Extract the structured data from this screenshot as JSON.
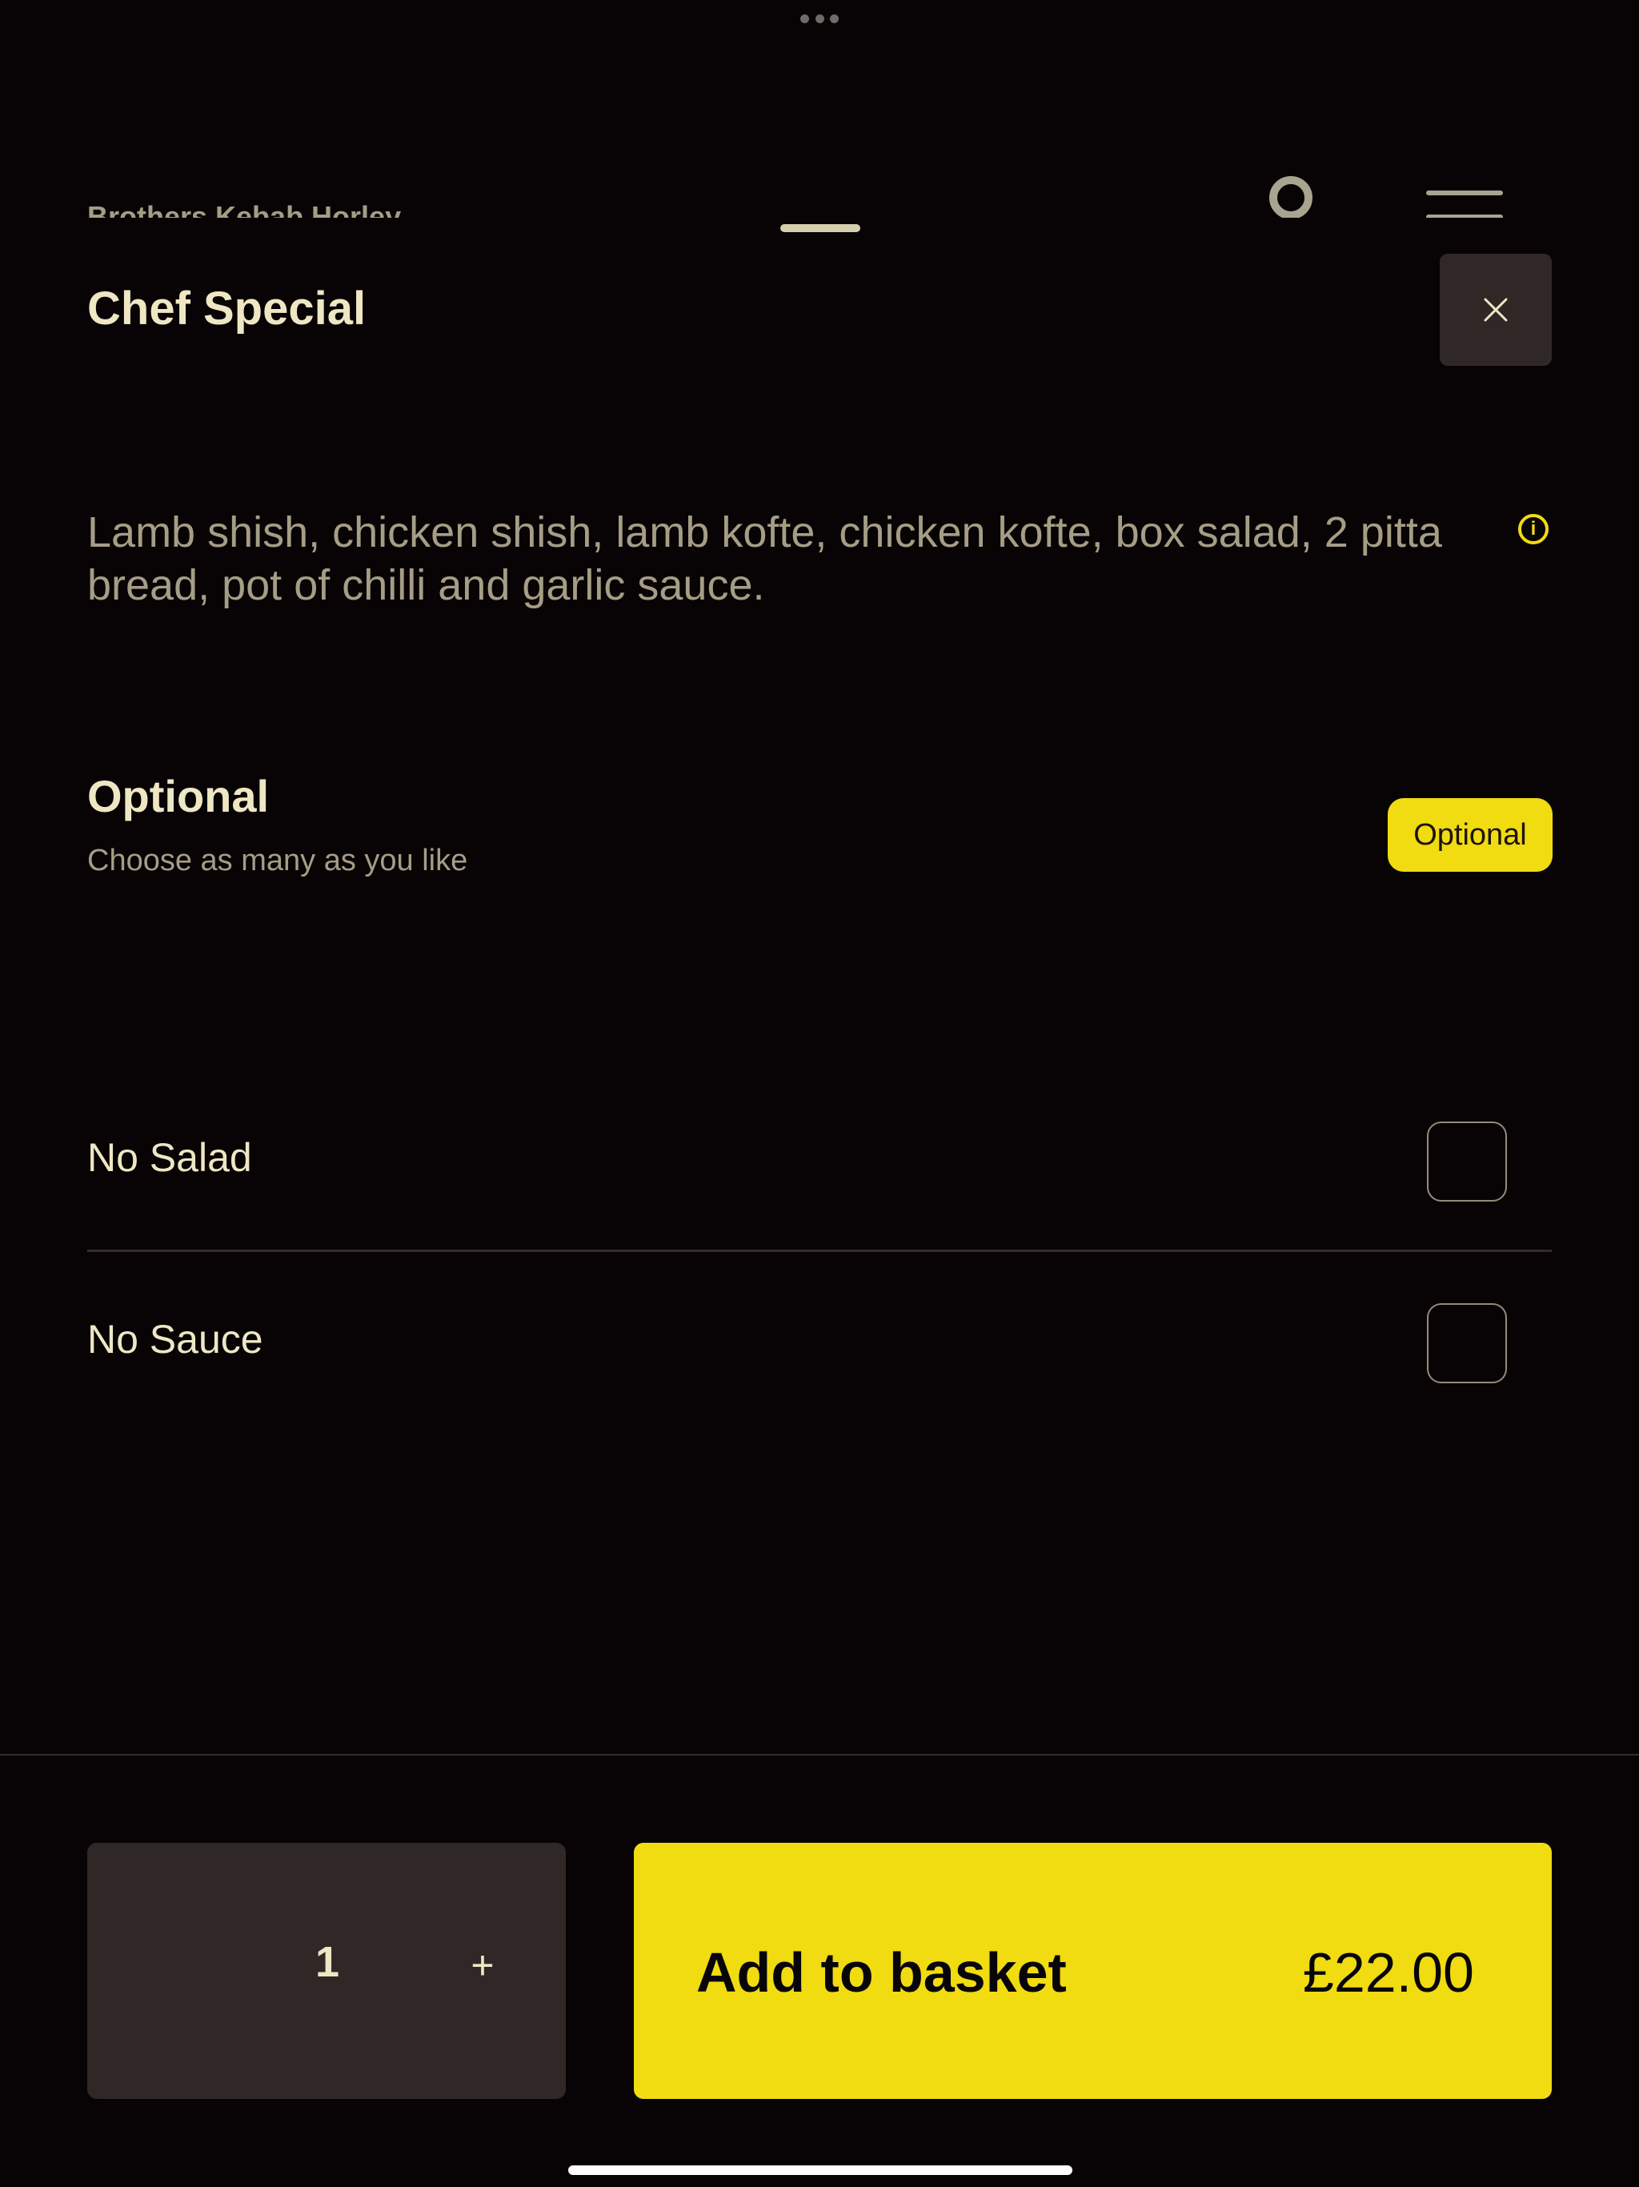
{
  "background_header": {
    "restaurant_name": "Brothers Kebab Horley"
  },
  "item": {
    "title": "Chef Special",
    "description": "Lamb shish, chicken shish, lamb kofte, chicken kofte, box salad, 2 pitta bread, pot of chilli and garlic sauce.",
    "info_icon_glyph": "i"
  },
  "option_group": {
    "title": "Optional",
    "subtitle": "Choose as many as you like",
    "badge": "Optional",
    "options": [
      {
        "label": "No Salad",
        "checked": false
      },
      {
        "label": "No Sauce",
        "checked": false
      }
    ]
  },
  "footer": {
    "quantity": "1",
    "increment_symbol": "+",
    "add_label": "Add to basket",
    "price": "£22.00"
  },
  "colors": {
    "background": "#080405",
    "accent": "#f1db11",
    "text_primary": "#efe6c4",
    "text_secondary": "#a59d85",
    "surface": "#302826"
  },
  "icons": {
    "close": "close-icon",
    "info": "info-icon",
    "account": "user-icon",
    "menu": "menu-icon"
  }
}
